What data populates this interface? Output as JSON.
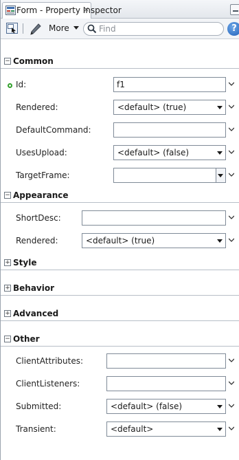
{
  "window": {
    "tab_title": "Form - Property Inspector",
    "tab_close": "×"
  },
  "toolbar": {
    "more_label": "More",
    "find_placeholder": "Find",
    "help_label": "?"
  },
  "sections": {
    "common": {
      "title": "Common",
      "expanded": true,
      "id_label": "Id:",
      "id_value": "f1",
      "rendered_label": "Rendered:",
      "rendered_value": "<default> (true)",
      "default_command_label": "DefaultCommand:",
      "default_command_value": "",
      "uses_upload_label": "UsesUpload:",
      "uses_upload_value": "<default> (false)",
      "target_frame_label": "TargetFrame:",
      "target_frame_value": ""
    },
    "appearance": {
      "title": "Appearance",
      "expanded": true,
      "short_desc_label": "ShortDesc:",
      "short_desc_value": "",
      "rendered_label": "Rendered:",
      "rendered_value": "<default> (true)"
    },
    "style": {
      "title": "Style",
      "expanded": false
    },
    "behavior": {
      "title": "Behavior",
      "expanded": false
    },
    "advanced": {
      "title": "Advanced",
      "expanded": false
    },
    "other": {
      "title": "Other",
      "expanded": true,
      "client_attributes_label": "ClientAttributes:",
      "client_attributes_value": "",
      "client_listeners_label": "ClientListeners:",
      "client_listeners_value": "",
      "submitted_label": "Submitted:",
      "submitted_value": "<default> (false)",
      "transient_label": "Transient:",
      "transient_value": "<default>"
    }
  },
  "toggle_glyphs": {
    "expanded": "−",
    "collapsed": "+"
  },
  "colors": {
    "required_dot": "#33a02c",
    "help_button": "#1f5fb8",
    "border": "#7f8a97"
  },
  "icons": {
    "tab_icon": "form-icon",
    "toolbar_icon": "select-component-icon",
    "edit_icon": "pencil-icon",
    "find_icon": "magnifier-icon",
    "help_icon": "help-icon"
  }
}
